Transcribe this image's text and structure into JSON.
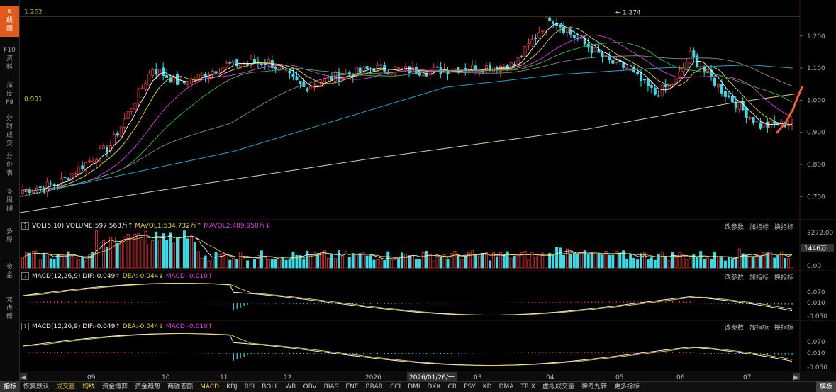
{
  "sidebar": [
    {
      "label": "K\n线\n图",
      "active": true
    },
    {
      "label": "F10\n资\n料"
    },
    {
      "label": "深\n度\nF9"
    },
    {
      "label": "分\n时\n成\n交"
    },
    {
      "label": "分\n价\n表"
    },
    {
      "label": "多\n周\n期"
    },
    {
      "label": "多\n股"
    },
    {
      "label": "资\n金"
    },
    {
      "label": "龙\n虎\n榜"
    }
  ],
  "price_panel": {
    "y_ticks": [
      "1.200",
      "1.100",
      "1.000",
      "0.900",
      "0.800",
      "0.700"
    ],
    "line_high_label": "1.262",
    "line_mid_label": "0.991",
    "peak_label": "1.274",
    "low_label": "0.717"
  },
  "volume_panel": {
    "indicator": "VOL(5,10)",
    "volume": "VOLUME:597.563万↑",
    "mavol1": "MAVOL1:534.732万↑",
    "mavol2": "MAVOL2:489.958万↓",
    "y_ticks": [
      "3272.00",
      "1446万",
      "0.00"
    ]
  },
  "macd_panels": [
    {
      "indicator": "MACD(12,26,9)",
      "dif": "DIF:-0.049↑",
      "dea": "DEA:-0.044↓",
      "macd": "MACD:-0.010↑",
      "y_ticks": [
        "0.070",
        "0.010",
        "-0.050"
      ]
    },
    {
      "indicator": "MACD(12,26,9)",
      "dif": "DIF:-0.049↑",
      "dea": "DEA:-0.044↓",
      "macd": "MACD:-0.010↑",
      "y_ticks": [
        "0.070",
        "0.010",
        "-0.050"
      ]
    }
  ],
  "panel_buttons": [
    "改参数",
    "加指标",
    "换指标"
  ],
  "x_axis": {
    "labels": [
      "09",
      "10",
      "11",
      "12",
      "2026",
      "03",
      "04",
      "05",
      "06",
      "07"
    ],
    "cursor_date": "2026/01/26/一"
  },
  "tabs": [
    "指标",
    "恢复默认",
    "成交量",
    "均线",
    "资金博弈",
    "资金趋势",
    "两融差额",
    "MACD",
    "KDJ",
    "RSI",
    "BOLL",
    "WR",
    "OBV",
    "BIAS",
    "ENE",
    "BRAR",
    "CCI",
    "DMI",
    "DKX",
    "CR",
    "PSY",
    "KD",
    "DMA",
    "TRIX",
    "虚拟成交量",
    "神奇九转",
    "更多指标",
    "模板"
  ],
  "highlight_tabs": [
    "成交量",
    "均线",
    "MACD"
  ],
  "colors": {
    "up": "#e03a3a",
    "down": "#3fd8e6",
    "ma5": "#ffffff",
    "ma10": "#e6d34a",
    "ma20": "#e040e0",
    "ma30": "#40c040",
    "ma60": "#8a8a8a",
    "ma120": "#1fa8c8",
    "ma250": "#d8d4a0",
    "hline": "#c8c83a",
    "annotation": "#f06040"
  }
}
